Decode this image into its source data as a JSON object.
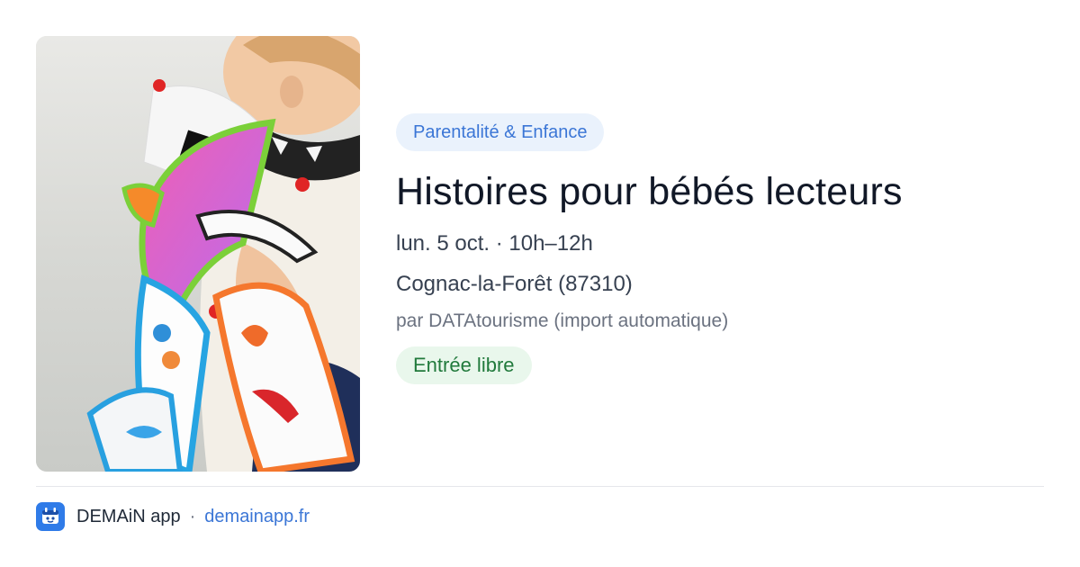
{
  "event": {
    "category": "Parentalité & Enfance",
    "title": "Histoires pour bébés lecteurs",
    "date": "lun. 5 oct. · 10h–12h",
    "place": "Cognac-la-Forêt (87310)",
    "source": "par DATAtourisme (import automatique)",
    "price": "Entrée libre"
  },
  "image": {
    "alt": "Toddler holding a colorful soft fabric baby book",
    "icon": "event-photo"
  },
  "footer": {
    "app_name": "DEMAiN app",
    "separator": "·",
    "url": "demainapp.fr",
    "logo_icon": "demain-logo-icon"
  },
  "colors": {
    "accent": "#3b76d6",
    "category_bg": "#eaf2fc",
    "price_text": "#217a3c",
    "price_bg": "#e9f7ec",
    "logo_bg": "#2f7be8"
  }
}
